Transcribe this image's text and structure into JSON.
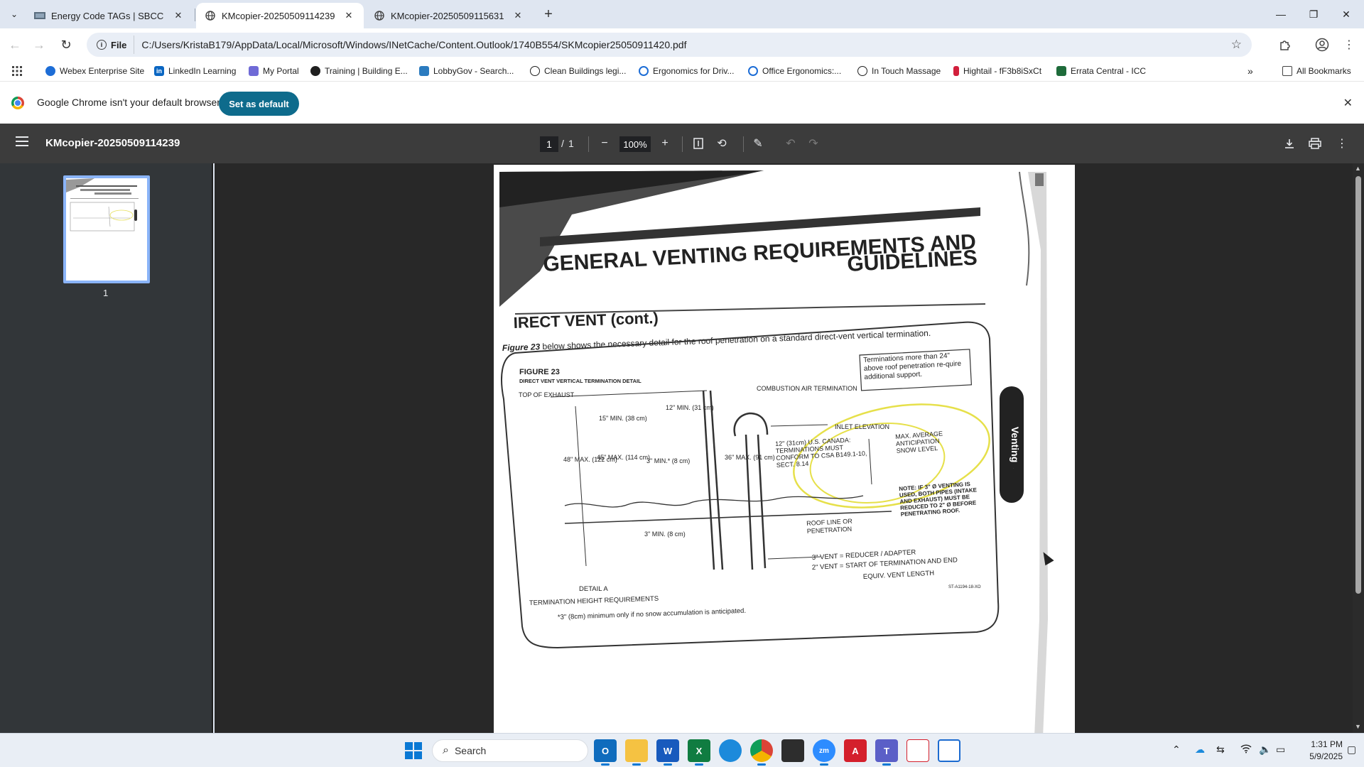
{
  "browser": {
    "tabs": [
      {
        "title": "Energy Code TAGs | SBCC",
        "active": false
      },
      {
        "title": "KMcopier-20250509114239",
        "active": true
      },
      {
        "title": "KMcopier-20250509115631",
        "active": false
      }
    ],
    "url_chip": "File",
    "url": "C:/Users/KristaB179/AppData/Local/Microsoft/Windows/INetCache/Content.Outlook/1740B554/SKMcopier25050911420.pdf"
  },
  "bookmarks": {
    "items": [
      {
        "label": "Webex Enterprise Site",
        "color": "#1d6dd6"
      },
      {
        "label": "LinkedIn Learning",
        "color": "#0a66c2"
      },
      {
        "label": "My Portal",
        "color": "#6f6ad6"
      },
      {
        "label": "Training | Building E...",
        "color": "#1f1f1f"
      },
      {
        "label": "LobbyGov - Search...",
        "color": "#2b7bbf"
      },
      {
        "label": "Clean Buildings legi...",
        "color": "#1f1f1f"
      },
      {
        "label": "Ergonomics for Driv...",
        "color": "#1d6dd6"
      },
      {
        "label": "Office Ergonomics:...",
        "color": "#1d6dd6"
      },
      {
        "label": "In Touch Massage",
        "color": "#1f1f1f"
      },
      {
        "label": "Hightail - fF3b8iSxCt",
        "color": "#d21f3c"
      },
      {
        "label": "Errata Central - ICC",
        "color": "#1e6b3a"
      }
    ],
    "all_bookmarks": "All Bookmarks"
  },
  "infobar": {
    "message": "Google Chrome isn't your default browser",
    "button": "Set as default"
  },
  "pdf": {
    "title": "KMcopier-20250509114239",
    "page_current": "1",
    "page_separator": "/",
    "page_total": "1",
    "zoom": "100%",
    "thumbnail_label": "1"
  },
  "document": {
    "heading_line1": "GENERAL VENTING REQUIREMENTS AND",
    "heading_line2": "GUIDELINES",
    "section": "IRECT VENT (cont.)",
    "intro_italic": "Figure 23",
    "intro": " below shows the necessary detail for the roof penetration on a standard direct-vent vertical termination.",
    "figure_title": "FIGURE 23",
    "figure_subtitle": "DIRECT VENT VERTICAL TERMINATION DETAIL",
    "callout": "Terminations more than 24\" above roof penetration re-quire additional support.",
    "side_tab": "Venting",
    "labels": {
      "top_exhaust": "TOP OF EXHAUST",
      "min15": "15\" MIN. (38 cm)",
      "min12": "12\" MIN. (31 cm)",
      "combustion": "COMBUSTION AIR TERMINATION",
      "inlet": "INLET ELEVATION",
      "max48": "48\" MAX. (122 cm)",
      "max45": "45\" MAX. (114 cm)",
      "min3a": "3\" MIN.* (8 cm)",
      "max36": "36\" MAX. (91 cm)",
      "canada": "12\" (31cm) U.S. CANADA: TERMINATIONS MUST CONFORM TO CSA B149.1-10, SECT. 8.14",
      "snow": "MAX. AVERAGE ANTICIPATION SNOW LEVEL",
      "note": "NOTE: IF 3\" Ø VENTING IS USED, BOTH PIPES (INTAKE AND EXHAUST) MUST BE REDUCED TO 2\" Ø BEFORE PENETRATING ROOF.",
      "roofline": "ROOF LINE OR PENETRATION",
      "min3b": "3\" MIN. (8 cm)",
      "vent3": "3\" VENT  =  REDUCER / ADAPTER",
      "vent2": "2\" VENT  =  START OF TERMINATION AND END",
      "equiv": "EQUIV. VENT LENGTH",
      "code": "ST-A1194-18-XO",
      "detail": "DETAIL A",
      "detail_sub": "TERMINATION HEIGHT REQUIREMENTS",
      "footnote": "*3\" (8cm) minimum only if no snow accumulation is anticipated."
    }
  },
  "taskbar": {
    "search_placeholder": "Search",
    "time": "1:31 PM",
    "date": "5/9/2025"
  }
}
